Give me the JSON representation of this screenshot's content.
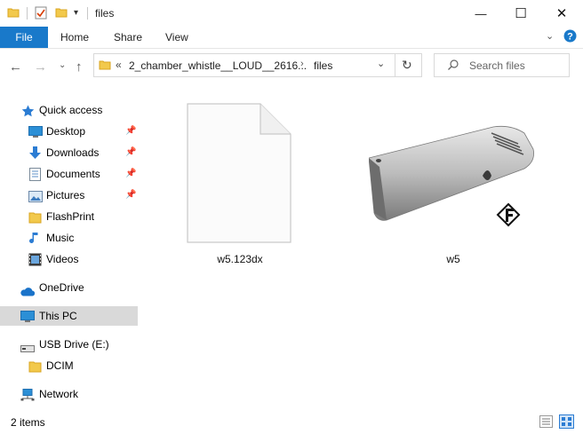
{
  "window": {
    "title": "files",
    "minimize_glyph": "—",
    "maximize_glyph": "☐",
    "close_glyph": "✕"
  },
  "ribbon": {
    "tabs": [
      {
        "label": "File"
      },
      {
        "label": "Home"
      },
      {
        "label": "Share"
      },
      {
        "label": "View"
      }
    ]
  },
  "address": {
    "overflow": "«",
    "crumbs": [
      {
        "label": "2_chamber_whistle__LOUD__2616..."
      },
      {
        "label": "files"
      }
    ],
    "search_placeholder": "Search files"
  },
  "sidebar": {
    "items": [
      {
        "label": "Quick access",
        "icon": "star-icon"
      },
      {
        "label": "Desktop",
        "icon": "desktop-icon",
        "pinned": true
      },
      {
        "label": "Downloads",
        "icon": "download-icon",
        "pinned": true
      },
      {
        "label": "Documents",
        "icon": "documents-icon",
        "pinned": true
      },
      {
        "label": "Pictures",
        "icon": "pictures-icon",
        "pinned": true
      },
      {
        "label": "FlashPrint",
        "icon": "folder-icon"
      },
      {
        "label": "Music",
        "icon": "music-icon"
      },
      {
        "label": "Videos",
        "icon": "videos-icon"
      },
      {
        "label": "OneDrive",
        "icon": "cloud-icon"
      },
      {
        "label": "This PC",
        "icon": "pc-icon",
        "selected": true
      },
      {
        "label": "USB Drive (E:)",
        "icon": "usb-drive-icon"
      },
      {
        "label": "DCIM",
        "icon": "folder-icon"
      },
      {
        "label": "Network",
        "icon": "network-icon"
      }
    ]
  },
  "files": [
    {
      "name": "w5.123dx",
      "icon": "blank-document-icon"
    },
    {
      "name": "w5",
      "icon": "whistle-thumbnail"
    }
  ],
  "status": {
    "count": "2 items"
  },
  "colors": {
    "accent": "#1979ca",
    "selected_row": "#d9d9d9",
    "folder": "#f2c94c"
  }
}
